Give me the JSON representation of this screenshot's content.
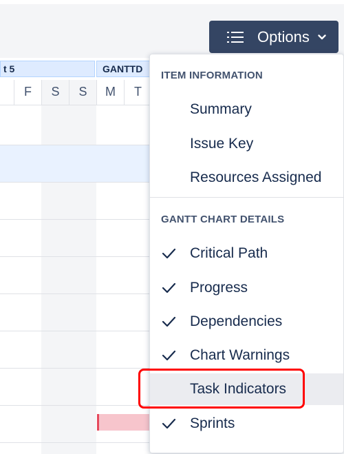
{
  "toolbar": {
    "options_label": "Options",
    "options_icon": "list-icon",
    "chevron_icon": "chevron-down-icon"
  },
  "gantt": {
    "sprints": [
      {
        "label": "t 5"
      },
      {
        "label": "GANTTD"
      }
    ],
    "days": [
      "F",
      "S",
      "S",
      "M",
      "T"
    ]
  },
  "menu": {
    "section1": {
      "heading": "ITEM INFORMATION",
      "items": [
        {
          "label": "Summary",
          "checked": false
        },
        {
          "label": "Issue Key",
          "checked": false
        },
        {
          "label": "Resources Assigned",
          "checked": false
        }
      ]
    },
    "section2": {
      "heading": "GANTT CHART DETAILS",
      "items": [
        {
          "label": "Critical Path",
          "checked": true
        },
        {
          "label": "Progress",
          "checked": true
        },
        {
          "label": "Dependencies",
          "checked": true
        },
        {
          "label": "Chart Warnings",
          "checked": true
        },
        {
          "label": "Task Indicators",
          "checked": false
        },
        {
          "label": "Sprints",
          "checked": true
        }
      ]
    }
  },
  "colors": {
    "button_bg": "#344563",
    "sprint_bg": "#deebff",
    "bar_fill": "#f7c5cc",
    "bar_edge": "#e5495d",
    "highlight_box": "#ff0000"
  }
}
